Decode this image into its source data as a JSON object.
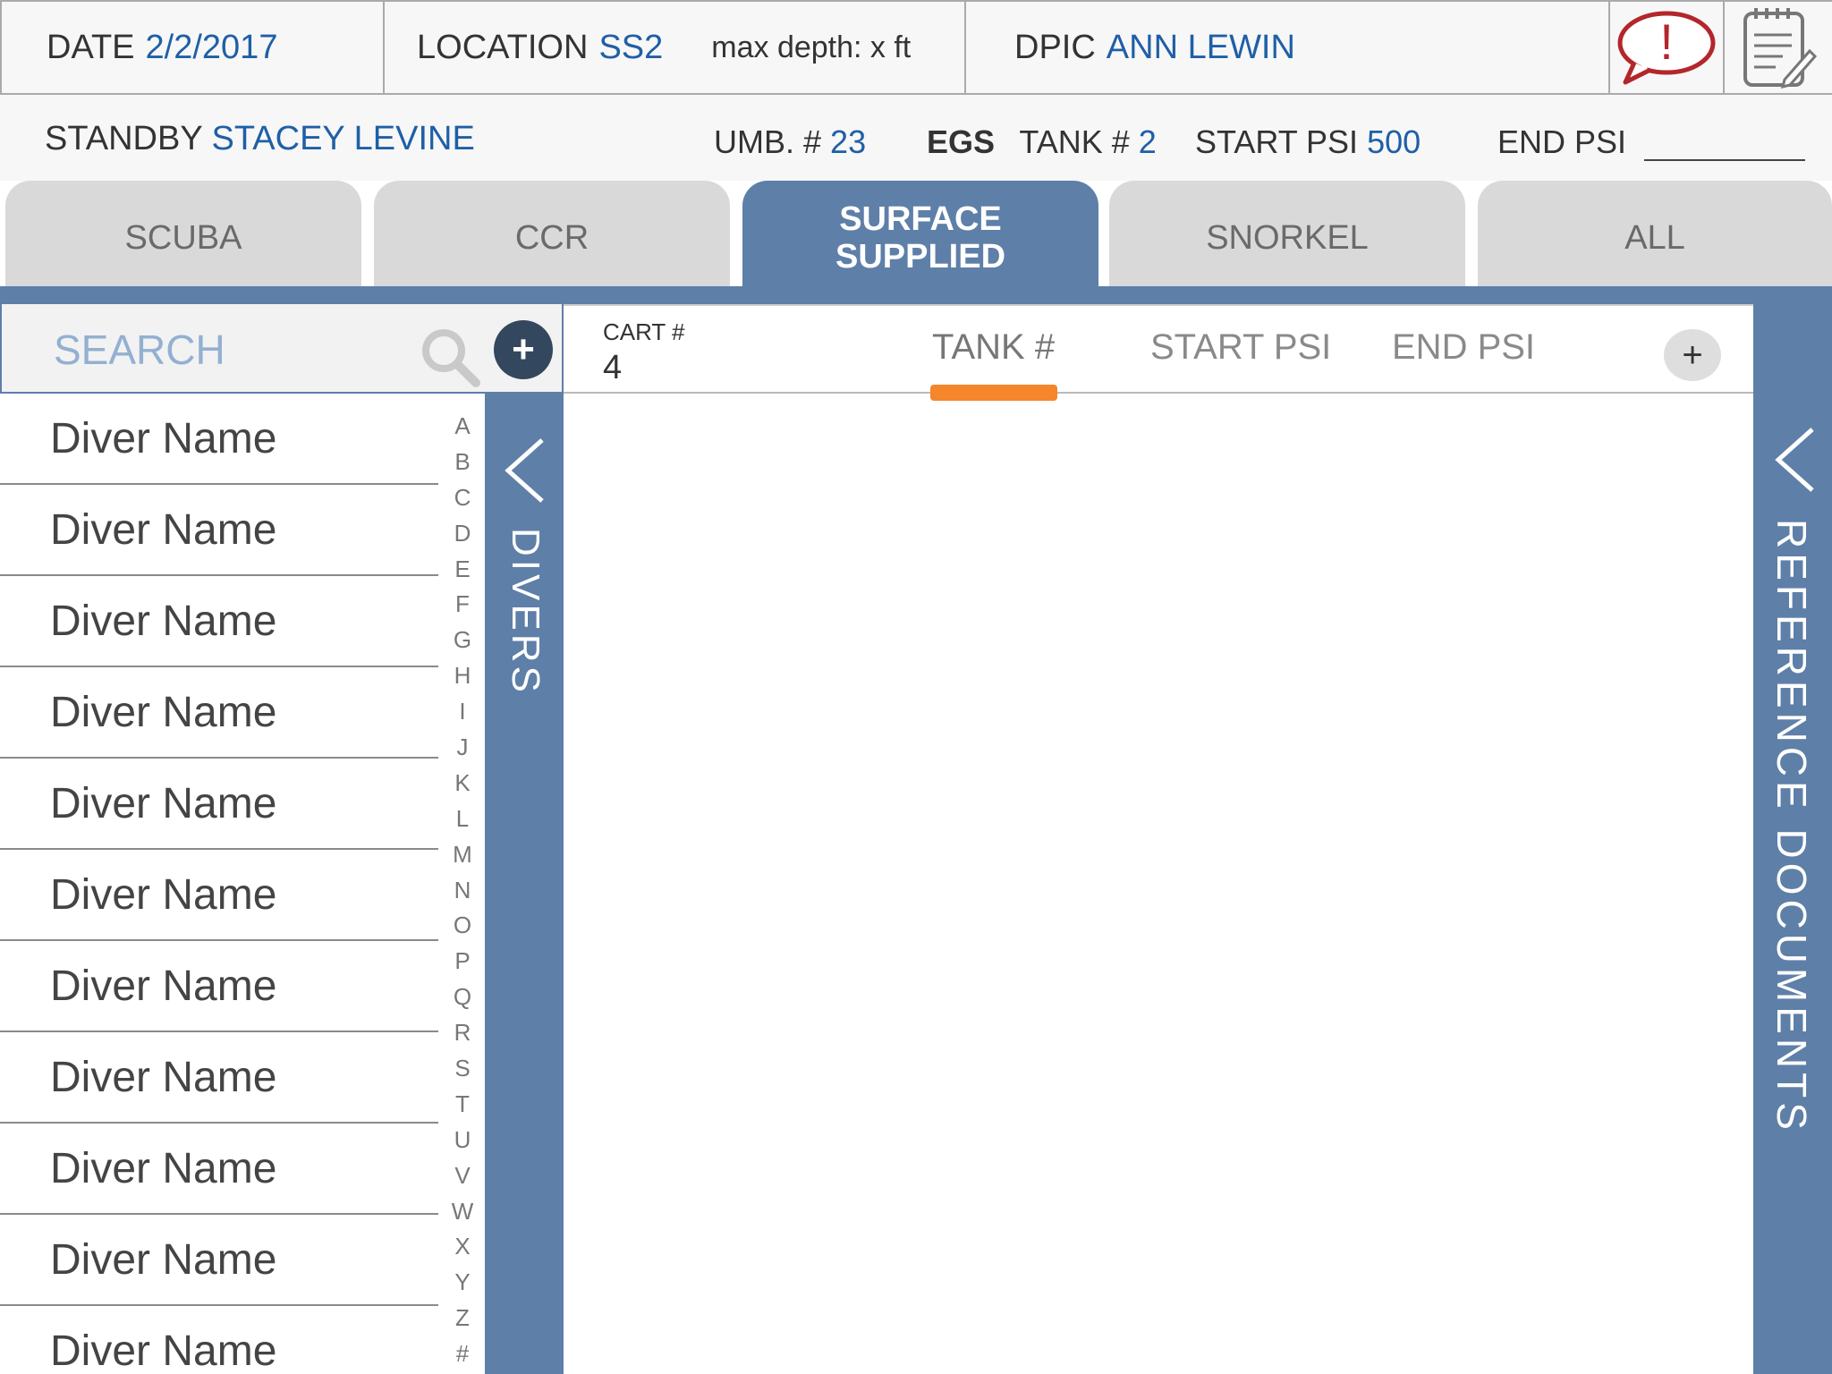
{
  "header": {
    "date_label": "DATE",
    "date_value": "2/2/2017",
    "location_label": "LOCATION",
    "location_value": "SS2",
    "max_depth": "max depth: x ft",
    "dpic_label": "DPIC",
    "dpic_value": "ANN LEWIN",
    "alert_symbol": "!",
    "icons": [
      "alert-speech-bubble-icon",
      "notepad-edit-icon"
    ]
  },
  "subheader": {
    "standby_label": "STANDBY",
    "standby_value": "STACEY LEVINE",
    "umb_label": "UMB. #",
    "umb_value": "23",
    "egs_label": "EGS",
    "tank_label": "TANK #",
    "tank_value": "2",
    "start_psi_label": "START PSI",
    "start_psi_value": "500",
    "end_psi_label": "END PSI"
  },
  "tabs": [
    {
      "label": "SCUBA",
      "active": false
    },
    {
      "label": "CCR",
      "active": false
    },
    {
      "label": "SURFACE",
      "label2": "SUPPLIED",
      "active": true
    },
    {
      "label": "SNORKEL",
      "active": false
    },
    {
      "label": "ALL",
      "active": false
    }
  ],
  "sidebar": {
    "search_placeholder": "SEARCH",
    "add_symbol": "+",
    "divers": [
      "Diver Name",
      "Diver Name",
      "Diver Name",
      "Diver Name",
      "Diver Name",
      "Diver Name",
      "Diver Name",
      "Diver Name",
      "Diver Name",
      "Diver Name",
      "Diver Name"
    ],
    "alphabet": [
      "A",
      "B",
      "C",
      "D",
      "E",
      "F",
      "G",
      "H",
      "I",
      "J",
      "K",
      "L",
      "M",
      "N",
      "O",
      "P",
      "Q",
      "R",
      "S",
      "T",
      "U",
      "V",
      "W",
      "X",
      "Y",
      "Z",
      "#"
    ],
    "handle_label": "DIVERS"
  },
  "main": {
    "cart_label": "CART #",
    "cart_value": "4",
    "columns": [
      "TANK #",
      "START PSI",
      "END PSI"
    ],
    "active_column": "TANK #",
    "active_color": "#f5862b",
    "add_symbol": "+"
  },
  "reference": {
    "handle_label": "REFERENCE DOCUMENTS"
  },
  "colors": {
    "accent": "#5e7fa8",
    "value_text": "#1f5fa6",
    "alert": "#b3262b"
  }
}
